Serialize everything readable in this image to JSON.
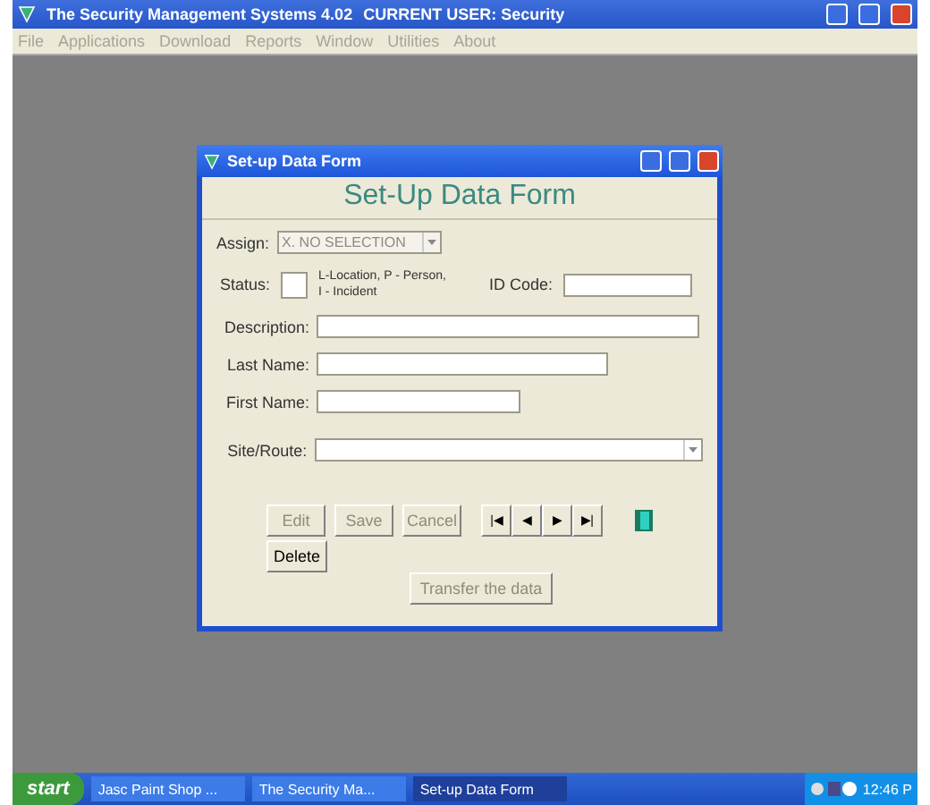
{
  "window": {
    "title": "The Security Management Systems 4.02",
    "user": "CURRENT USER: Security"
  },
  "menu": [
    {
      "label": "File"
    },
    {
      "label": "Applications"
    },
    {
      "label": "Download"
    },
    {
      "label": "Reports"
    },
    {
      "label": "Window"
    },
    {
      "label": "Utilities"
    },
    {
      "label": "About"
    }
  ],
  "dialog": {
    "title": "Set-up Data Form",
    "heading": "Set-Up Data Form",
    "assign": {
      "label": "Assign:",
      "value": "X. NO SELECTION",
      "disabled": true
    },
    "status": {
      "label": "Status:",
      "hint_lines": [
        "L-Location, P - Person,",
        "I - Incident"
      ]
    },
    "id_code": {
      "label": "ID Code:"
    },
    "description": {
      "label": "Description:"
    },
    "last_name": {
      "label": "Last Name:"
    },
    "first_name": {
      "label": "First Name:"
    },
    "site_route": {
      "label": "Site/Route:"
    },
    "buttons": [
      {
        "label": "Edit",
        "disabled": true
      },
      {
        "label": "Save",
        "disabled": true
      },
      {
        "label": "Cancel",
        "disabled": true
      }
    ],
    "nav": [
      "|◀",
      "◀",
      "▶",
      "▶|"
    ],
    "delete": {
      "label": "Delete",
      "disabled": false
    },
    "transfer": {
      "label": "Transfer the data",
      "disabled": true
    }
  },
  "taskbar": {
    "start": "start",
    "tasks": [
      {
        "label": "Jasc Paint Shop ...",
        "selected": false
      },
      {
        "label": "The Security Ma...",
        "selected": false
      },
      {
        "label": "Set-up Data Form",
        "selected": true
      }
    ],
    "clock": "12:46 P"
  }
}
